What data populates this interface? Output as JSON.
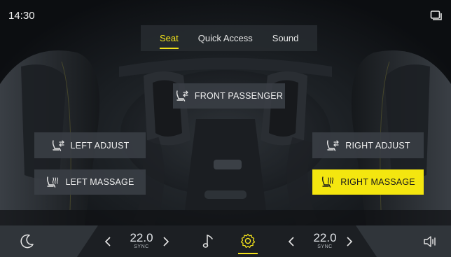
{
  "status_bar": {
    "time": "14:30",
    "right_icon": "screen-cast-icon"
  },
  "tabs": [
    {
      "label": "Seat",
      "active": true
    },
    {
      "label": "Quick Access",
      "active": false
    },
    {
      "label": "Sound",
      "active": false
    }
  ],
  "seat_controls": {
    "front_passenger": {
      "label": "FRONT PASSENGER",
      "icon": "seat-adjust-icon",
      "active": false
    },
    "left_adjust": {
      "label": "LEFT ADJUST",
      "icon": "seat-adjust-icon",
      "active": false
    },
    "right_adjust": {
      "label": "RIGHT ADJUST",
      "icon": "seat-adjust-icon",
      "active": false
    },
    "left_massage": {
      "label": "LEFT MASSAGE",
      "icon": "seat-massage-icon",
      "active": false
    },
    "right_massage": {
      "label": "RIGHT MASSAGE",
      "icon": "seat-massage-icon",
      "active": true
    }
  },
  "bottom_bar": {
    "night_mode_icon": "moon-icon",
    "left_temp": {
      "value": "22.0",
      "sync_label": "SYNC"
    },
    "music_icon": "music-note-icon",
    "settings_icon": "gear-icon",
    "settings_active": true,
    "right_temp": {
      "value": "22.0",
      "sync_label": "SYNC"
    },
    "volume_icon": "speaker-icon"
  },
  "colors": {
    "accent": "#f4e60f",
    "panel": "#3a3f45",
    "bar": "#30353a",
    "bar_center": "#1c1f23"
  }
}
